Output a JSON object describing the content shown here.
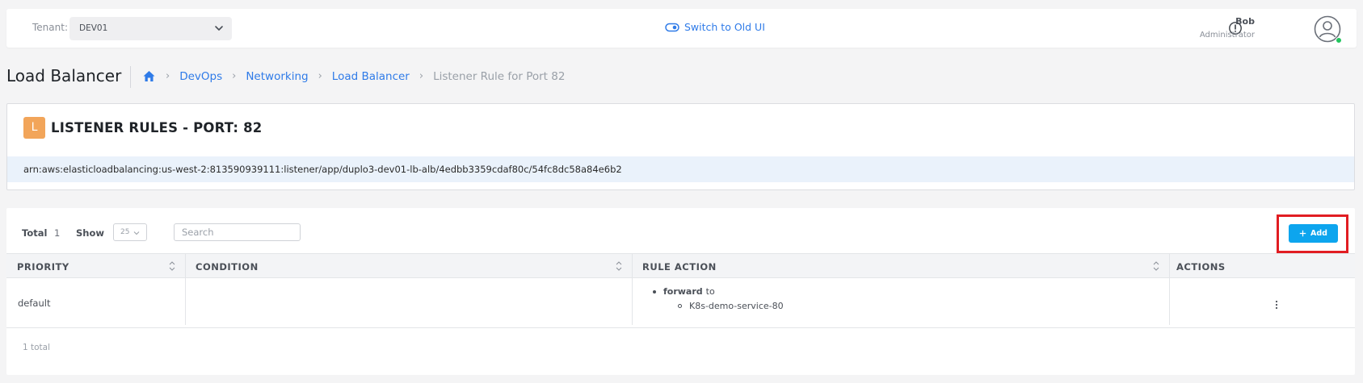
{
  "topbar": {
    "tenant_label": "Tenant:",
    "tenant_value": "DEV01",
    "switch_label": "Switch to Old UI",
    "user_name": "Bob",
    "user_role": "Administrator"
  },
  "page": {
    "title": "Load Balancer",
    "breadcrumb": [
      "DevOps",
      "Networking",
      "Load Balancer"
    ],
    "breadcrumb_current": "Listener Rule for Port 82"
  },
  "header_card": {
    "badge": "L",
    "title": "LISTENER RULES - PORT: 82",
    "arn": "arn:aws:elasticloadbalancing:us-west-2:813590939111:listener/app/duplo3-dev01-lb-alb/4edbb3359cdaf80c/54fc8dc58a84e6b2"
  },
  "table": {
    "total_label": "Total",
    "total_value": "1",
    "show_label": "Show",
    "page_size": "25",
    "search_placeholder": "Search",
    "add_label": "Add",
    "columns": [
      "PRIORITY",
      "CONDITION",
      "RULE ACTION",
      "ACTIONS"
    ],
    "rows": [
      {
        "priority": "default",
        "condition": "",
        "action_type": "forward",
        "action_suffix": "to",
        "action_target": "K8s-demo-service-80"
      }
    ],
    "footer": "1 total"
  },
  "colors": {
    "accent": "#2f7be8",
    "add_button": "#0da5ee",
    "badge": "#f2a55a",
    "highlight": "#e11d22",
    "status_online": "#22c55e"
  }
}
